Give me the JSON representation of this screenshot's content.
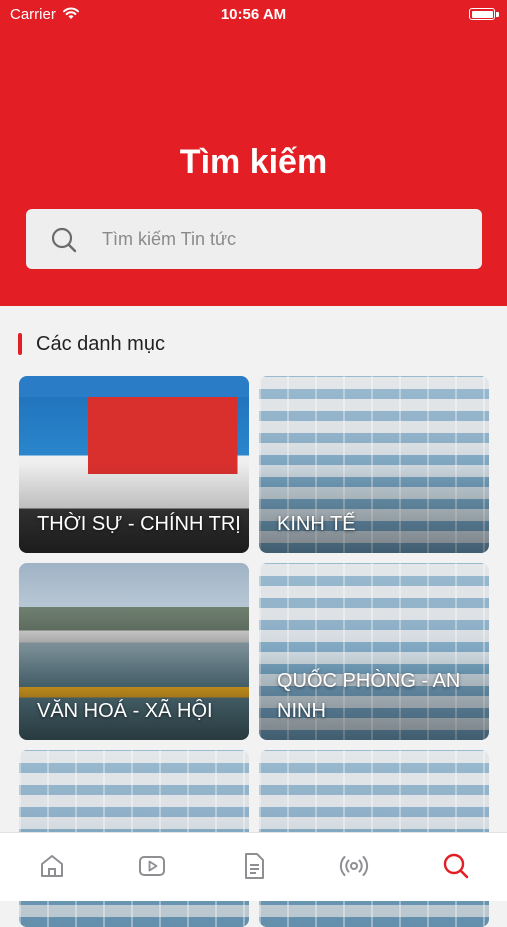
{
  "status_bar": {
    "carrier": "Carrier",
    "time": "10:56 AM"
  },
  "header": {
    "title": "Tìm kiếm",
    "background_color": "#e31e24"
  },
  "search": {
    "placeholder": "Tìm kiếm Tin tức",
    "value": ""
  },
  "section": {
    "title": "Các danh mục",
    "accent_color": "#e31e24"
  },
  "categories": [
    {
      "label": "THỜI SỰ - CHÍNH TRỊ",
      "image": "conference-photo"
    },
    {
      "label": "KINH TẾ",
      "image": "factory-photo"
    },
    {
      "label": "VĂN HOÁ - XÃ HỘI",
      "image": "boat-race-photo"
    },
    {
      "label": "QUỐC PHÒNG - AN NINH",
      "image": "factory-photo"
    },
    {
      "label": "",
      "image": "factory-photo"
    },
    {
      "label": "",
      "image": "factory-photo"
    }
  ],
  "tabbar": {
    "items": [
      {
        "icon": "home-icon",
        "active": false
      },
      {
        "icon": "video-icon",
        "active": false
      },
      {
        "icon": "document-icon",
        "active": false
      },
      {
        "icon": "broadcast-icon",
        "active": false
      },
      {
        "icon": "search-icon",
        "active": true
      }
    ],
    "active_color": "#e31e24",
    "inactive_color": "#8e8e93"
  }
}
